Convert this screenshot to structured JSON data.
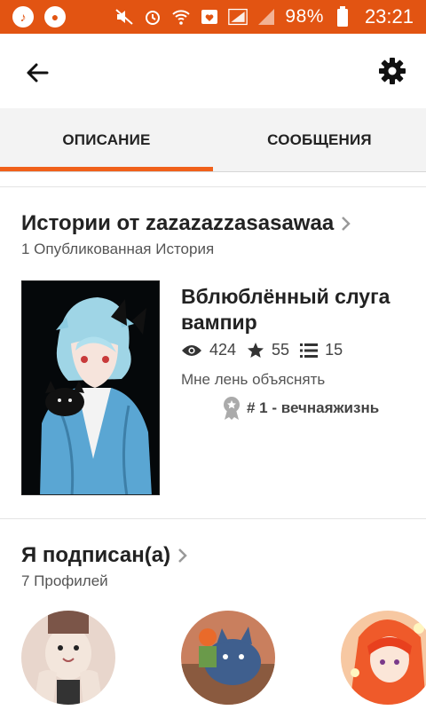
{
  "status_bar": {
    "battery": "98%",
    "time": "23:21"
  },
  "header": {
    "back_icon": "arrow-left-icon",
    "settings_icon": "gear-icon"
  },
  "tabs": [
    {
      "label": "ОПИСАНИЕ",
      "active": true
    },
    {
      "label": "СООБЩЕНИЯ",
      "active": false
    }
  ],
  "stories": {
    "title": "Истории от zazazazzasasawaa",
    "subtitle": "1 Опубликованная История",
    "items": [
      {
        "title": "Вблюблённый слуга вампир",
        "views": "424",
        "votes": "55",
        "parts": "15",
        "description": "Мне лень объяснять",
        "rank": "# 1 - вечнаяжизнь"
      }
    ]
  },
  "following": {
    "title": "Я подписан(а)",
    "subtitle": "7 Профилей"
  },
  "colors": {
    "status_bar": "#e25412",
    "accent": "#f0601a"
  }
}
